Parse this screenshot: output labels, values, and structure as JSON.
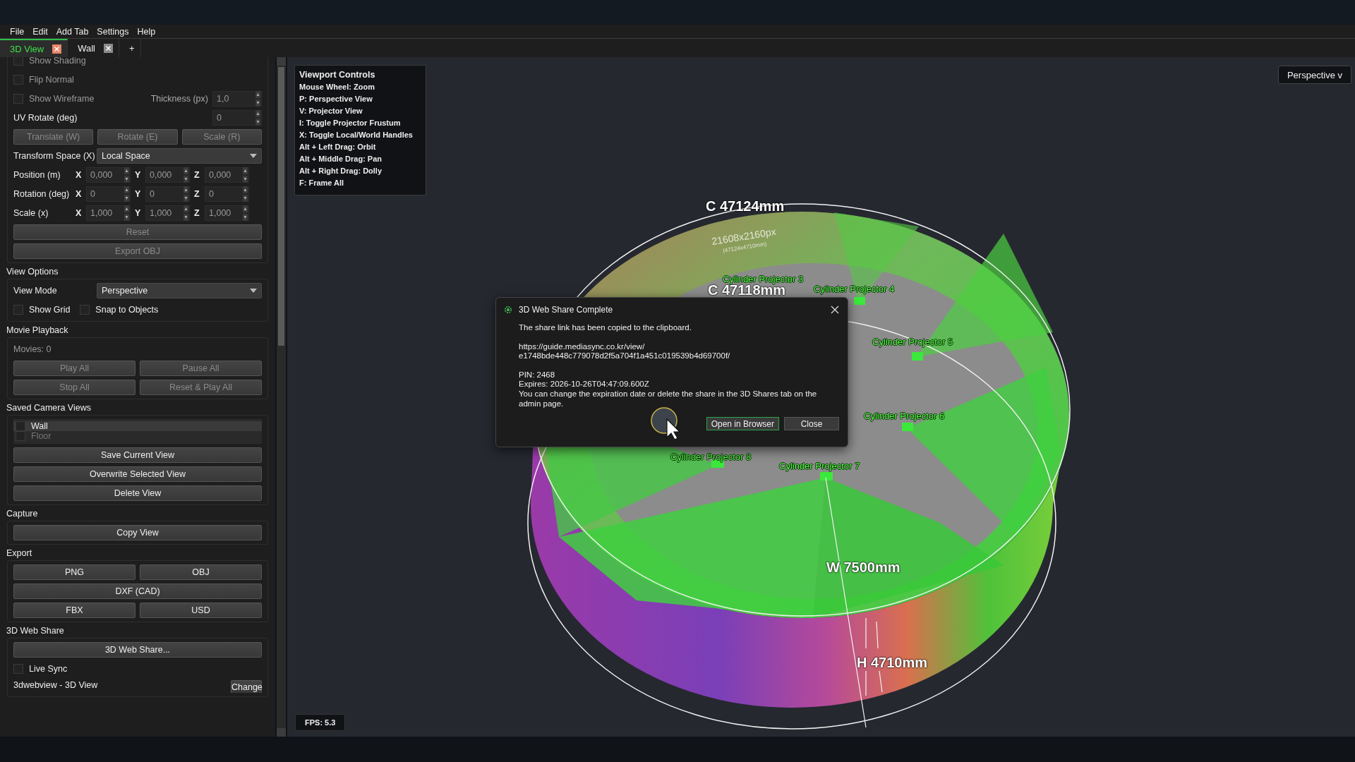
{
  "menu": [
    "File",
    "Edit",
    "Add Tab",
    "Settings",
    "Help"
  ],
  "tabs": [
    {
      "label": "3D View",
      "selected": true,
      "closable": true
    },
    {
      "label": "Wall",
      "selected": false,
      "closable": true
    },
    {
      "label": "+",
      "selected": false,
      "closable": false
    }
  ],
  "sidebar": {
    "sections": [
      {
        "rows": [
          {
            "kind": "checkbox",
            "label": "Show Shading",
            "checked": false,
            "disabled": true
          },
          {
            "kind": "checkbox",
            "label": "Flip Normal",
            "checked": false,
            "disabled": true
          },
          {
            "kind": "check_spin",
            "label": "Show Wireframe",
            "checked": false,
            "disabled": true,
            "field_label": "Thickness (px)",
            "value": "1,0"
          },
          {
            "kind": "spin",
            "label": "UV Rotate (deg)",
            "value": "0"
          },
          {
            "kind": "buttons",
            "buttons": [
              {
                "label": "Translate (W)",
                "disabled": true
              },
              {
                "label": "Rotate (E)",
                "disabled": true
              },
              {
                "label": "Scale (R)",
                "disabled": true
              }
            ]
          },
          {
            "kind": "dropdown",
            "label": "Transform Space (X)",
            "value": "Local Space"
          },
          {
            "kind": "xyz",
            "label": "Position (m)",
            "fields": [
              {
                "axis": "X",
                "value": "0,000"
              },
              {
                "axis": "Y",
                "value": "0,000"
              },
              {
                "axis": "Z",
                "value": "0,000"
              }
            ]
          },
          {
            "kind": "xyz",
            "label": "Rotation (deg)",
            "fields": [
              {
                "axis": "X",
                "value": "0"
              },
              {
                "axis": "Y",
                "value": "0"
              },
              {
                "axis": "Z",
                "value": "0"
              }
            ]
          },
          {
            "kind": "xyz",
            "label": "Scale (x)",
            "fields": [
              {
                "axis": "X",
                "value": "1,000"
              },
              {
                "axis": "Y",
                "value": "1,000"
              },
              {
                "axis": "Z",
                "value": "1,000"
              }
            ]
          },
          {
            "kind": "buttons",
            "buttons": [
              {
                "label": "Reset",
                "disabled": true
              }
            ]
          },
          {
            "kind": "buttons",
            "buttons": [
              {
                "label": "Export OBJ",
                "disabled": true
              }
            ]
          }
        ]
      },
      {
        "title": "View Options",
        "rows": [
          {
            "kind": "dropdown",
            "label": "View Mode",
            "value": "Perspective"
          },
          {
            "kind": "checks",
            "items": [
              {
                "label": "Show Grid",
                "checked": false,
                "disabled": false
              },
              {
                "label": "Snap to Objects",
                "checked": false,
                "disabled": false
              }
            ]
          }
        ]
      },
      {
        "title": "Movie Playback",
        "rows": [
          {
            "kind": "note",
            "text": "Movies: 0"
          },
          {
            "kind": "buttons",
            "buttons": [
              {
                "label": "Play All",
                "disabled": true
              },
              {
                "label": "Pause All",
                "disabled": true
              }
            ]
          },
          {
            "kind": "buttons",
            "buttons": [
              {
                "label": "Stop All",
                "disabled": true
              },
              {
                "label": "Reset & Play All",
                "disabled": true
              }
            ]
          }
        ]
      },
      {
        "title": "Saved Camera Views",
        "rows": [
          {
            "kind": "list",
            "items": [
              {
                "label": "Wall",
                "selected": true,
                "checked": false
              },
              {
                "label": "Floor",
                "selected": false,
                "checked": false
              }
            ]
          },
          {
            "kind": "buttons",
            "buttons": [
              {
                "label": "Save Current View",
                "disabled": false
              }
            ]
          },
          {
            "kind": "buttons",
            "buttons": [
              {
                "label": "Overwrite Selected View",
                "disabled": false
              }
            ]
          },
          {
            "kind": "buttons",
            "buttons": [
              {
                "label": "Delete View",
                "disabled": false
              }
            ]
          }
        ]
      },
      {
        "title": "Capture",
        "rows": [
          {
            "kind": "buttons",
            "buttons": [
              {
                "label": "Copy View",
                "disabled": false
              }
            ]
          }
        ]
      },
      {
        "title": "Export",
        "rows": [
          {
            "kind": "buttons",
            "buttons": [
              {
                "label": "PNG",
                "disabled": false
              },
              {
                "label": "OBJ",
                "disabled": false
              }
            ]
          },
          {
            "kind": "buttons",
            "buttons": [
              {
                "label": "DXF (CAD)",
                "disabled": false
              }
            ]
          },
          {
            "kind": "buttons",
            "buttons": [
              {
                "label": "FBX",
                "disabled": false
              },
              {
                "label": "USD",
                "disabled": false
              }
            ]
          }
        ]
      },
      {
        "title": "3D Web Share",
        "rows": [
          {
            "kind": "buttons",
            "buttons": [
              {
                "label": "3D Web Share...",
                "disabled": false
              }
            ]
          },
          {
            "kind": "checkbox",
            "label": "Live Sync",
            "checked": false,
            "disabled": false
          },
          {
            "kind": "label_button",
            "text": "3dwebview - 3D View",
            "button": "Change"
          }
        ]
      }
    ]
  },
  "viewport": {
    "help": {
      "title": "Viewport Controls",
      "lines": [
        "Mouse Wheel: Zoom",
        "P: Perspective View",
        "V: Projector View",
        "I: Toggle Projector Frustum",
        "X: Toggle Local/World Handles",
        "Alt + Left Drag: Orbit",
        "Alt + Middle Drag: Pan",
        "Alt + Right Drag: Dolly",
        "F: Frame All"
      ]
    },
    "view_mode": "Perspective v",
    "scene_labels": [
      {
        "kind": "dimension",
        "text": "C 47124mm"
      },
      {
        "kind": "texture",
        "text": "21608x2160px"
      },
      {
        "kind": "texture_small",
        "text": "(47124x4710mm)"
      },
      {
        "kind": "projector",
        "text": "Cylinder Projector 3"
      },
      {
        "kind": "dimension",
        "text": "C 47118mm"
      },
      {
        "kind": "projector",
        "text": "Cylinder Projector 4"
      },
      {
        "kind": "projector",
        "text": "Cylinder Projector 5"
      },
      {
        "kind": "projector",
        "text": "Cylinder Projector 6"
      },
      {
        "kind": "projector",
        "text": "Cylinder Projector 8"
      },
      {
        "kind": "projector",
        "text": "Cylinder Projector 7"
      },
      {
        "kind": "dimension",
        "text": "W 7500mm"
      },
      {
        "kind": "dimension",
        "text": "H 4710mm"
      }
    ],
    "fps": "FPS: 5.3",
    "dialog": {
      "title": "3D Web Share Complete",
      "message": "The share link has been copied to the clipboard.",
      "url_lines": [
        "https://guide.mediasync.co.kr/view/",
        "e1748bde448c779078d2f5a704f1a451c019539b4d69700f/"
      ],
      "details": [
        "PIN: 2468",
        "Expires: 2026-10-26T04:47:09.600Z",
        "You can change the expiration date or delete the share in the 3D Shares tab on the admin page."
      ],
      "buttons": [
        {
          "label": "Open in Browser",
          "default": true
        },
        {
          "label": "Close",
          "default": false
        }
      ]
    }
  }
}
